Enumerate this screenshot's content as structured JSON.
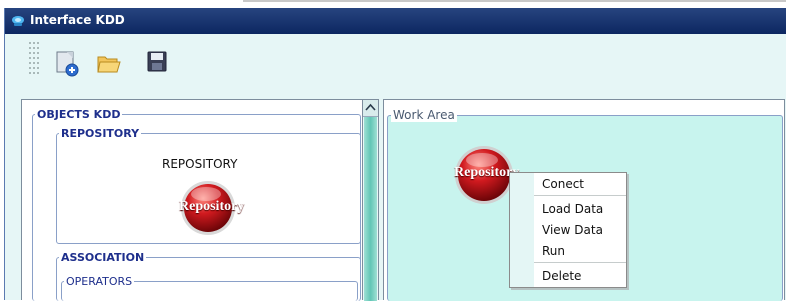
{
  "window": {
    "title": "Interface KDD"
  },
  "toolbar": {
    "buttons": [
      {
        "name": "new-document",
        "icon": "new-document-icon"
      },
      {
        "name": "open-folder",
        "icon": "folder-open-icon"
      },
      {
        "name": "save",
        "icon": "floppy-disk-icon"
      }
    ]
  },
  "objects_panel": {
    "title": "OBJECTS KDD",
    "repository_group": {
      "title": "REPOSITORY",
      "caption": "REPOSITORY",
      "ball_label": "Repository"
    },
    "association_group": {
      "title": "ASSOCIATION",
      "operators_title": "OPERATORS"
    }
  },
  "work_area": {
    "title": "Work Area",
    "node_label": "Repository"
  },
  "context_menu": {
    "items": [
      "Conect",
      "Load Data",
      "View Data",
      "Run",
      "Delete"
    ]
  },
  "colors": {
    "titlebar": "#0c2761",
    "work_area_bg": "#c8f4ee",
    "group_title": "#1e2f8c",
    "repository_ball": "#c4161c"
  }
}
